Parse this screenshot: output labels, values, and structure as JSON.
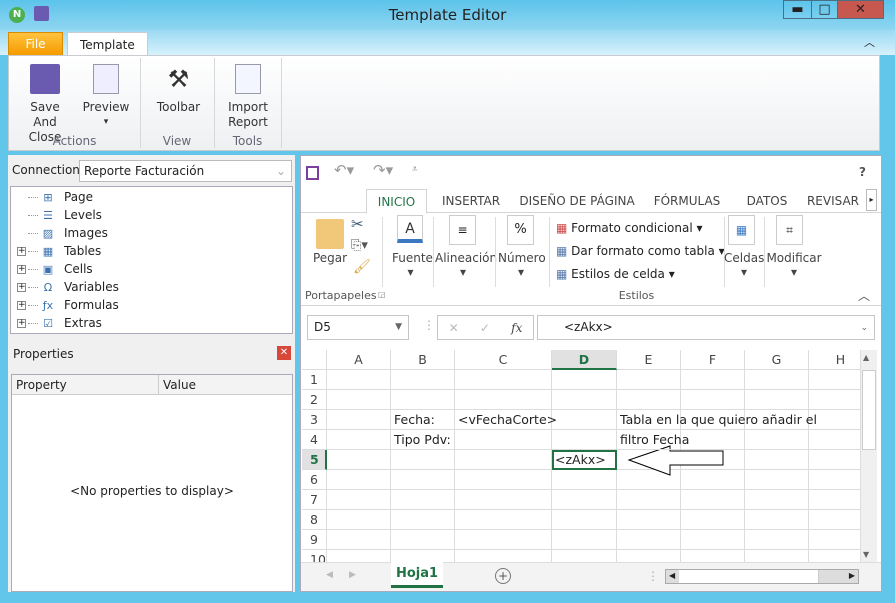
{
  "window": {
    "title": "Template Editor",
    "minimize": "▬",
    "maximize": "□",
    "close": "✕"
  },
  "ribbon": {
    "tabs": [
      {
        "label": "File",
        "active": false
      },
      {
        "label": "Template",
        "active": true
      }
    ],
    "buttons": [
      {
        "label1": "Save And",
        "label2": "Close",
        "icon": "save-close-icon"
      },
      {
        "label1": "Preview",
        "label2": "▾",
        "icon": "preview-magnifier-icon"
      },
      {
        "label1": "Toolbar",
        "label2": "",
        "icon": "tools-icon"
      },
      {
        "label1": "Import",
        "label2": "Report",
        "icon": "import-report-icon"
      }
    ],
    "groups": [
      "Actions",
      "View",
      "Tools"
    ]
  },
  "connection": {
    "label": "Connection",
    "value": "Reporte Facturación"
  },
  "tree": [
    {
      "label": "Page",
      "expandable": false,
      "icon": "page-icon"
    },
    {
      "label": "Levels",
      "expandable": false,
      "icon": "levels-icon"
    },
    {
      "label": "Images",
      "expandable": false,
      "icon": "image-icon"
    },
    {
      "label": "Tables",
      "expandable": true,
      "icon": "table-icon"
    },
    {
      "label": "Cells",
      "expandable": true,
      "icon": "cell-icon"
    },
    {
      "label": "Variables",
      "expandable": true,
      "icon": "omega-icon"
    },
    {
      "label": "Formulas",
      "expandable": true,
      "icon": "fx-icon"
    },
    {
      "label": "Extras",
      "expandable": true,
      "icon": "extras-icon"
    }
  ],
  "properties": {
    "title": "Properties",
    "col_property": "Property",
    "col_value": "Value",
    "empty": "<No properties to display>"
  },
  "excel": {
    "qat_help": "?",
    "tabs": [
      "INICIO",
      "INSERTAR",
      "DISEÑO DE PÁGINA",
      "FÓRMULAS",
      "DATOS",
      "REVISAR"
    ],
    "active_tab": "INICIO",
    "groups": {
      "pegar": "Pegar",
      "fuente": "Fuente",
      "alineacion": "Alineación",
      "numero": "Número",
      "celdas": "Celdas",
      "modificar": "Modificar",
      "portapapeles": "Portapapeles",
      "estilos": "Estilos"
    },
    "styles": [
      "Formato condicional",
      "Dar formato como tabla",
      "Estilos de celda"
    ],
    "namebox": "D5",
    "formula": "<zAkx>",
    "fx": "fx",
    "columns": [
      "A",
      "B",
      "C",
      "D",
      "E",
      "F",
      "G",
      "H"
    ],
    "rows": [
      "1",
      "2",
      "3",
      "4",
      "5",
      "6",
      "7",
      "8",
      "9",
      "10"
    ],
    "selected_cell": "D5",
    "cells": {
      "B3": "Fecha:",
      "C3": "<vFechaCorte>",
      "E3": "Tabla en la que quiero añadir el",
      "B4": "Tipo Pdv:",
      "E4": "filtro Fecha",
      "D5": "<zAkx>"
    },
    "sheet_tab": "Hoja1",
    "accent": "#217346"
  }
}
